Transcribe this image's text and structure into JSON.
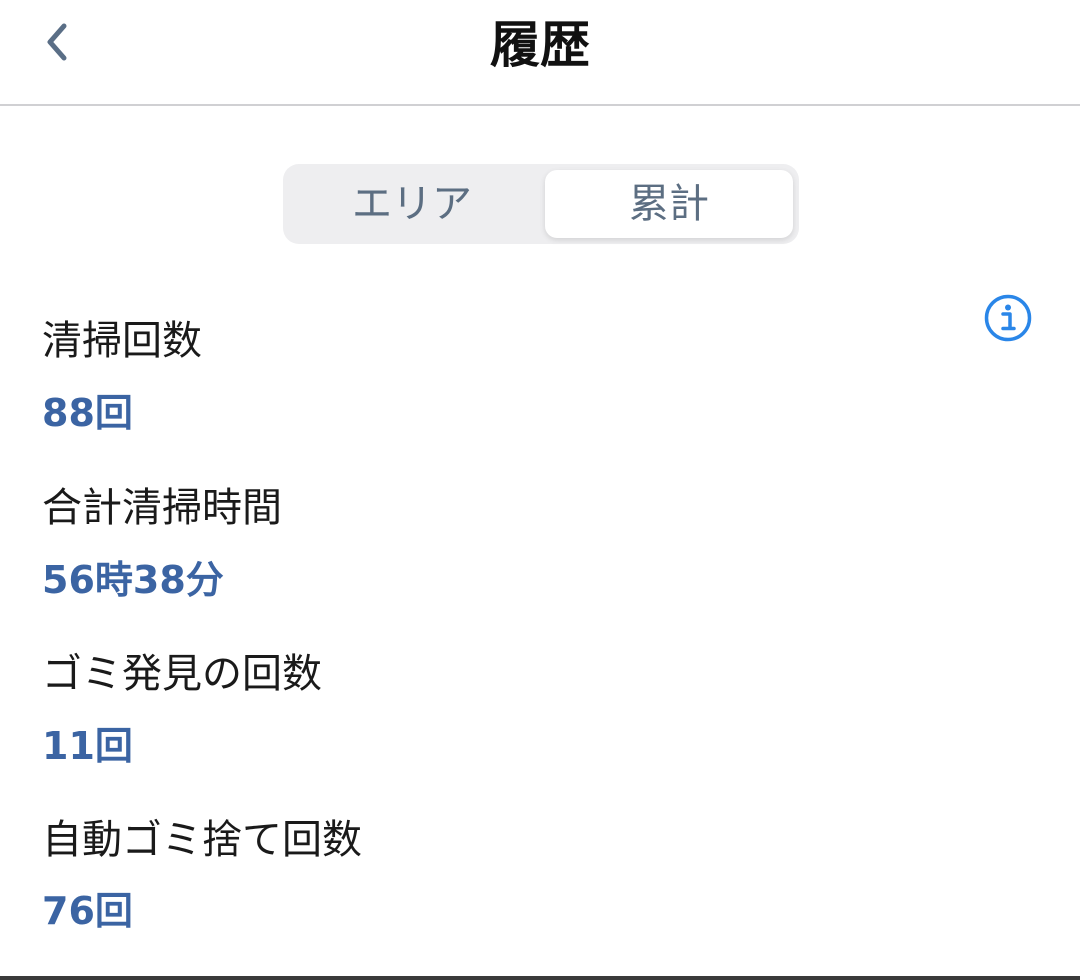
{
  "header": {
    "title": "履歴",
    "back_icon": "chevron-left-icon"
  },
  "tabs": [
    {
      "label": "エリア",
      "selected": false
    },
    {
      "label": "累計",
      "selected": true
    }
  ],
  "info_icon": "info-icon",
  "stats": [
    {
      "label": "清掃回数",
      "value": "88回"
    },
    {
      "label": "合計清掃時間",
      "value": "56時38分"
    },
    {
      "label": "ゴミ発見の回数",
      "value": "11回"
    },
    {
      "label": "自動ゴミ捨て回数",
      "value": "76回"
    }
  ],
  "colors": {
    "accent": "#3b64a3",
    "info": "#2a86e8",
    "tab_text": "#5c6e82"
  }
}
